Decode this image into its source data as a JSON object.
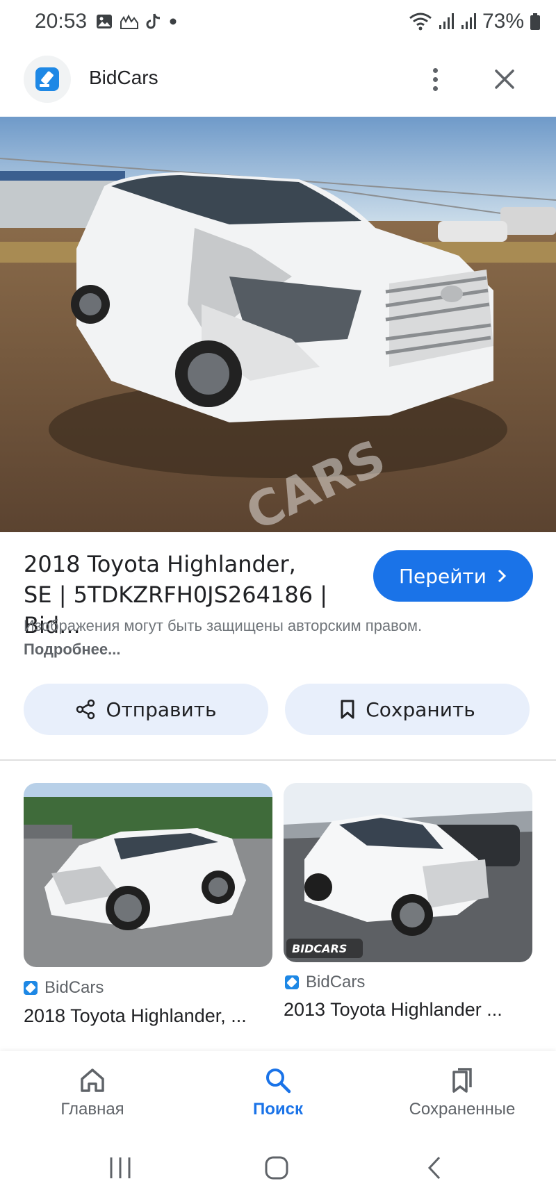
{
  "status_bar": {
    "time": "20:53",
    "battery": "73%",
    "icons_left": [
      "image-icon",
      "gallery-icon",
      "tiktok-icon",
      "dot-icon"
    ],
    "icons_right": [
      "wifi-icon",
      "signal-icon",
      "signal-icon",
      "battery-icon"
    ]
  },
  "header": {
    "site_name": "BidCars"
  },
  "hero": {
    "watermark": "CARS"
  },
  "result": {
    "title": "2018 Toyota Highlander, SE | 5TDKZRFH0JS264186 | Bid...",
    "goto_label": "Перейти",
    "copyright_text": "Изображения могут быть защищены авторским правом.",
    "more_link": "Подробнее..."
  },
  "actions": {
    "share_label": "Отправить",
    "save_label": "Сохранить"
  },
  "related": [
    {
      "source": "BidCars",
      "title": "2018 Toyota Highlander, ..."
    },
    {
      "source": "BidCars",
      "title": "2013 Toyota Highlander ...",
      "watermark": "BIDCARS"
    }
  ],
  "bottom_nav": {
    "items": [
      {
        "label": "Главная",
        "icon": "home-icon"
      },
      {
        "label": "Поиск",
        "icon": "search-icon"
      },
      {
        "label": "Сохраненные",
        "icon": "bookmarks-icon"
      }
    ],
    "active_index": 1
  },
  "colors": {
    "accent": "#1a73e8",
    "button_bg": "#e8effb",
    "site_icon": "#1e88e5"
  }
}
